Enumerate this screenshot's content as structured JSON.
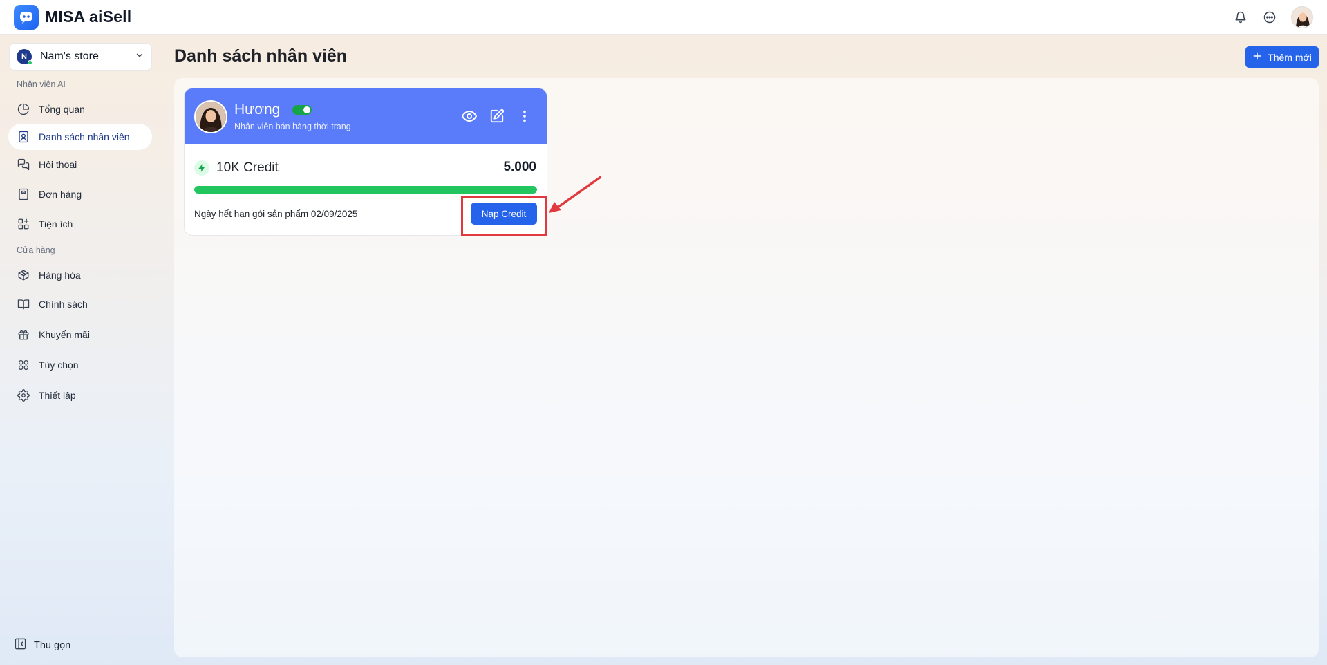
{
  "header": {
    "app_title": "MISA aiSell",
    "icons": [
      "bell-icon",
      "chat-bubble-icon",
      "user-avatar"
    ]
  },
  "sidebar": {
    "store": {
      "initial": "N",
      "name": "Nam's store"
    },
    "section_ai": "Nhân viên AI",
    "section_store": "Cửa hàng",
    "items": [
      {
        "label": "Tổng quan",
        "icon": "pie-chart-icon"
      },
      {
        "label": "Danh sách nhân viên",
        "icon": "staff-badge-icon",
        "active": true
      },
      {
        "label": "Hội thoại",
        "icon": "conversation-icon"
      },
      {
        "label": "Đơn hàng",
        "icon": "order-icon"
      },
      {
        "label": "Tiện ích",
        "icon": "apps-icon"
      },
      {
        "label": "Hàng hóa",
        "icon": "box-icon"
      },
      {
        "label": "Chính sách",
        "icon": "book-icon"
      },
      {
        "label": "Khuyến mãi",
        "icon": "gift-icon"
      },
      {
        "label": "Tùy chọn",
        "icon": "grid-icon"
      },
      {
        "label": "Thiết lập",
        "icon": "gear-icon"
      }
    ],
    "collapse_label": "Thu gọn"
  },
  "main": {
    "title": "Danh sách nhân viên",
    "add_button": "Thêm mới"
  },
  "card": {
    "name": "Hương",
    "role": "Nhân viên bán hàng thời trang",
    "active": true,
    "credit_label": "10K Credit",
    "credit_value": "5.000",
    "progress": 1.0,
    "expiry_text": "Ngày hết hạn gói sản phẩm 02/09/2025",
    "topup_button": "Nạp Credit"
  },
  "colors": {
    "primary": "#2563eb",
    "card_header": "#5b7cfa",
    "progress": "#22c55e",
    "highlight": "#e0393e"
  }
}
